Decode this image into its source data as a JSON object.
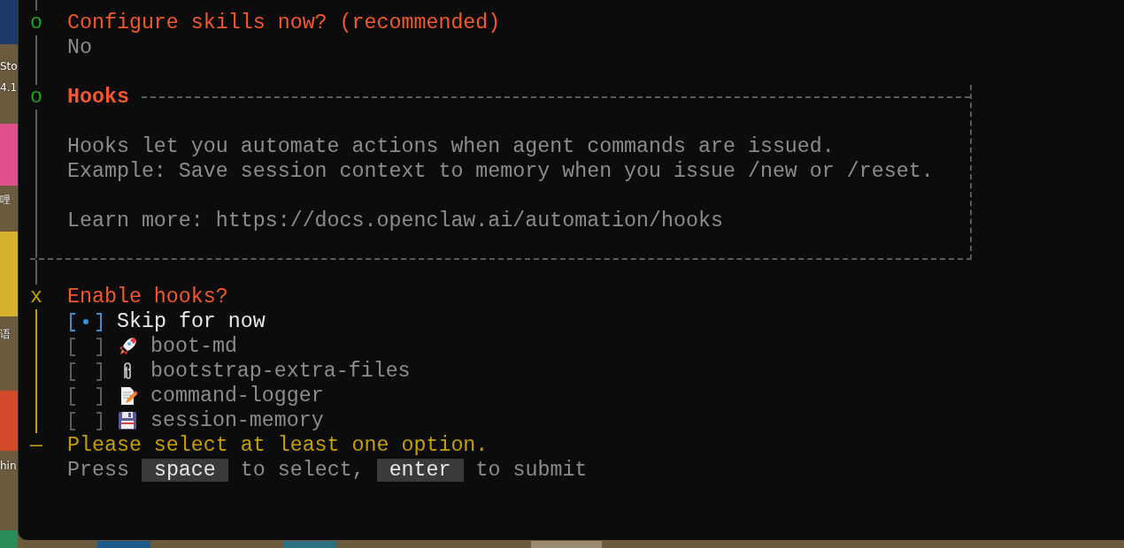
{
  "desktop": {
    "icon_labels": [
      {
        "text": "Sto"
      },
      {
        "text": "4.1"
      },
      {
        "text": "哩"
      },
      {
        "text": "语"
      },
      {
        "text": "hin"
      }
    ]
  },
  "terminal": {
    "previous_step": {
      "marker": "o",
      "title": "Configure skills now? (recommended)",
      "answer": "No"
    },
    "note": {
      "marker": "o",
      "title": "Hooks",
      "lines": [
        "Hooks let you automate actions when agent commands are issued.",
        "Example: Save session context to memory when you issue /new or /reset."
      ],
      "learn_more": "Learn more: https://docs.openclaw.ai/automation/hooks"
    },
    "prompt": {
      "marker": "x",
      "title": "Enable hooks?",
      "options": [
        {
          "label": "Skip for now",
          "checked": true
        },
        {
          "label": "boot-md",
          "checked": false
        },
        {
          "label": "bootstrap-extra-files",
          "checked": false
        },
        {
          "label": "command-logger",
          "checked": false
        },
        {
          "label": "session-memory",
          "checked": false
        }
      ],
      "error_marker": "—",
      "error": "Please select at least one option.",
      "hint": [
        {
          "kind": "text",
          "text": "Press"
        },
        {
          "kind": "key",
          "text": "space"
        },
        {
          "kind": "text",
          "text": "to select,"
        },
        {
          "kind": "key",
          "text": "enter"
        },
        {
          "kind": "text",
          "text": "to submit"
        }
      ]
    }
  }
}
